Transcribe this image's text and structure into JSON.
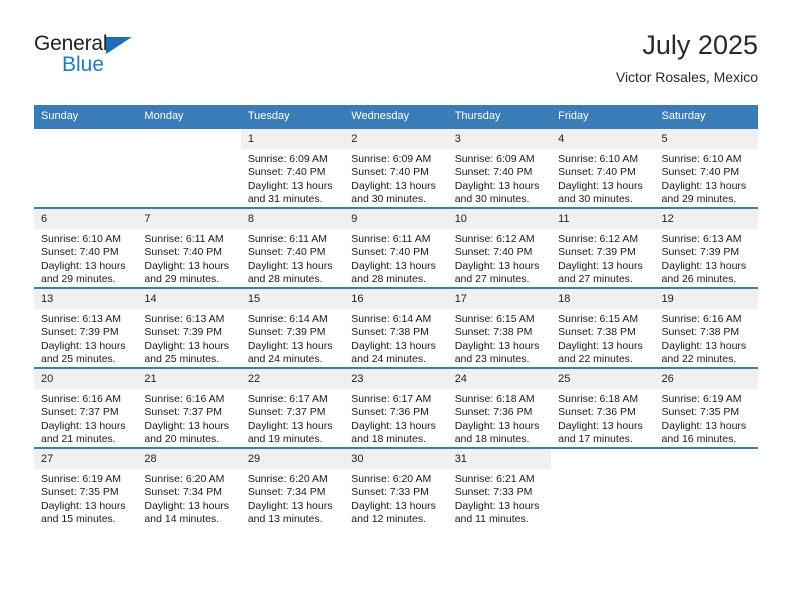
{
  "brand": {
    "name_top": "General",
    "name_bottom": "Blue",
    "accent_color": "#1b6fb5",
    "text_color": "#231f20"
  },
  "header": {
    "title": "July 2025",
    "subtitle": "Victor Rosales, Mexico"
  },
  "theme": {
    "header_bg": "#3a7cb8",
    "header_text": "#ffffff",
    "daynum_bg": "#f0f0f0",
    "row_border": "#3a7cb8"
  },
  "weekday_headers": [
    "Sunday",
    "Monday",
    "Tuesday",
    "Wednesday",
    "Thursday",
    "Friday",
    "Saturday"
  ],
  "weeks": [
    [
      {
        "day": "",
        "blank": true,
        "sunrise": "",
        "sunset": "",
        "daylight1": "",
        "daylight2": ""
      },
      {
        "day": "",
        "blank": true,
        "sunrise": "",
        "sunset": "",
        "daylight1": "",
        "daylight2": ""
      },
      {
        "day": "1",
        "sunrise": "Sunrise: 6:09 AM",
        "sunset": "Sunset: 7:40 PM",
        "daylight1": "Daylight: 13 hours",
        "daylight2": "and 31 minutes."
      },
      {
        "day": "2",
        "sunrise": "Sunrise: 6:09 AM",
        "sunset": "Sunset: 7:40 PM",
        "daylight1": "Daylight: 13 hours",
        "daylight2": "and 30 minutes."
      },
      {
        "day": "3",
        "sunrise": "Sunrise: 6:09 AM",
        "sunset": "Sunset: 7:40 PM",
        "daylight1": "Daylight: 13 hours",
        "daylight2": "and 30 minutes."
      },
      {
        "day": "4",
        "sunrise": "Sunrise: 6:10 AM",
        "sunset": "Sunset: 7:40 PM",
        "daylight1": "Daylight: 13 hours",
        "daylight2": "and 30 minutes."
      },
      {
        "day": "5",
        "sunrise": "Sunrise: 6:10 AM",
        "sunset": "Sunset: 7:40 PM",
        "daylight1": "Daylight: 13 hours",
        "daylight2": "and 29 minutes."
      }
    ],
    [
      {
        "day": "6",
        "sunrise": "Sunrise: 6:10 AM",
        "sunset": "Sunset: 7:40 PM",
        "daylight1": "Daylight: 13 hours",
        "daylight2": "and 29 minutes."
      },
      {
        "day": "7",
        "sunrise": "Sunrise: 6:11 AM",
        "sunset": "Sunset: 7:40 PM",
        "daylight1": "Daylight: 13 hours",
        "daylight2": "and 29 minutes."
      },
      {
        "day": "8",
        "sunrise": "Sunrise: 6:11 AM",
        "sunset": "Sunset: 7:40 PM",
        "daylight1": "Daylight: 13 hours",
        "daylight2": "and 28 minutes."
      },
      {
        "day": "9",
        "sunrise": "Sunrise: 6:11 AM",
        "sunset": "Sunset: 7:40 PM",
        "daylight1": "Daylight: 13 hours",
        "daylight2": "and 28 minutes."
      },
      {
        "day": "10",
        "sunrise": "Sunrise: 6:12 AM",
        "sunset": "Sunset: 7:40 PM",
        "daylight1": "Daylight: 13 hours",
        "daylight2": "and 27 minutes."
      },
      {
        "day": "11",
        "sunrise": "Sunrise: 6:12 AM",
        "sunset": "Sunset: 7:39 PM",
        "daylight1": "Daylight: 13 hours",
        "daylight2": "and 27 minutes."
      },
      {
        "day": "12",
        "sunrise": "Sunrise: 6:13 AM",
        "sunset": "Sunset: 7:39 PM",
        "daylight1": "Daylight: 13 hours",
        "daylight2": "and 26 minutes."
      }
    ],
    [
      {
        "day": "13",
        "sunrise": "Sunrise: 6:13 AM",
        "sunset": "Sunset: 7:39 PM",
        "daylight1": "Daylight: 13 hours",
        "daylight2": "and 25 minutes."
      },
      {
        "day": "14",
        "sunrise": "Sunrise: 6:13 AM",
        "sunset": "Sunset: 7:39 PM",
        "daylight1": "Daylight: 13 hours",
        "daylight2": "and 25 minutes."
      },
      {
        "day": "15",
        "sunrise": "Sunrise: 6:14 AM",
        "sunset": "Sunset: 7:39 PM",
        "daylight1": "Daylight: 13 hours",
        "daylight2": "and 24 minutes."
      },
      {
        "day": "16",
        "sunrise": "Sunrise: 6:14 AM",
        "sunset": "Sunset: 7:38 PM",
        "daylight1": "Daylight: 13 hours",
        "daylight2": "and 24 minutes."
      },
      {
        "day": "17",
        "sunrise": "Sunrise: 6:15 AM",
        "sunset": "Sunset: 7:38 PM",
        "daylight1": "Daylight: 13 hours",
        "daylight2": "and 23 minutes."
      },
      {
        "day": "18",
        "sunrise": "Sunrise: 6:15 AM",
        "sunset": "Sunset: 7:38 PM",
        "daylight1": "Daylight: 13 hours",
        "daylight2": "and 22 minutes."
      },
      {
        "day": "19",
        "sunrise": "Sunrise: 6:16 AM",
        "sunset": "Sunset: 7:38 PM",
        "daylight1": "Daylight: 13 hours",
        "daylight2": "and 22 minutes."
      }
    ],
    [
      {
        "day": "20",
        "sunrise": "Sunrise: 6:16 AM",
        "sunset": "Sunset: 7:37 PM",
        "daylight1": "Daylight: 13 hours",
        "daylight2": "and 21 minutes."
      },
      {
        "day": "21",
        "sunrise": "Sunrise: 6:16 AM",
        "sunset": "Sunset: 7:37 PM",
        "daylight1": "Daylight: 13 hours",
        "daylight2": "and 20 minutes."
      },
      {
        "day": "22",
        "sunrise": "Sunrise: 6:17 AM",
        "sunset": "Sunset: 7:37 PM",
        "daylight1": "Daylight: 13 hours",
        "daylight2": "and 19 minutes."
      },
      {
        "day": "23",
        "sunrise": "Sunrise: 6:17 AM",
        "sunset": "Sunset: 7:36 PM",
        "daylight1": "Daylight: 13 hours",
        "daylight2": "and 18 minutes."
      },
      {
        "day": "24",
        "sunrise": "Sunrise: 6:18 AM",
        "sunset": "Sunset: 7:36 PM",
        "daylight1": "Daylight: 13 hours",
        "daylight2": "and 18 minutes."
      },
      {
        "day": "25",
        "sunrise": "Sunrise: 6:18 AM",
        "sunset": "Sunset: 7:36 PM",
        "daylight1": "Daylight: 13 hours",
        "daylight2": "and 17 minutes."
      },
      {
        "day": "26",
        "sunrise": "Sunrise: 6:19 AM",
        "sunset": "Sunset: 7:35 PM",
        "daylight1": "Daylight: 13 hours",
        "daylight2": "and 16 minutes."
      }
    ],
    [
      {
        "day": "27",
        "sunrise": "Sunrise: 6:19 AM",
        "sunset": "Sunset: 7:35 PM",
        "daylight1": "Daylight: 13 hours",
        "daylight2": "and 15 minutes."
      },
      {
        "day": "28",
        "sunrise": "Sunrise: 6:20 AM",
        "sunset": "Sunset: 7:34 PM",
        "daylight1": "Daylight: 13 hours",
        "daylight2": "and 14 minutes."
      },
      {
        "day": "29",
        "sunrise": "Sunrise: 6:20 AM",
        "sunset": "Sunset: 7:34 PM",
        "daylight1": "Daylight: 13 hours",
        "daylight2": "and 13 minutes."
      },
      {
        "day": "30",
        "sunrise": "Sunrise: 6:20 AM",
        "sunset": "Sunset: 7:33 PM",
        "daylight1": "Daylight: 13 hours",
        "daylight2": "and 12 minutes."
      },
      {
        "day": "31",
        "sunrise": "Sunrise: 6:21 AM",
        "sunset": "Sunset: 7:33 PM",
        "daylight1": "Daylight: 13 hours",
        "daylight2": "and 11 minutes."
      },
      {
        "day": "",
        "blank": true,
        "sunrise": "",
        "sunset": "",
        "daylight1": "",
        "daylight2": ""
      },
      {
        "day": "",
        "blank": true,
        "sunrise": "",
        "sunset": "",
        "daylight1": "",
        "daylight2": ""
      }
    ]
  ]
}
